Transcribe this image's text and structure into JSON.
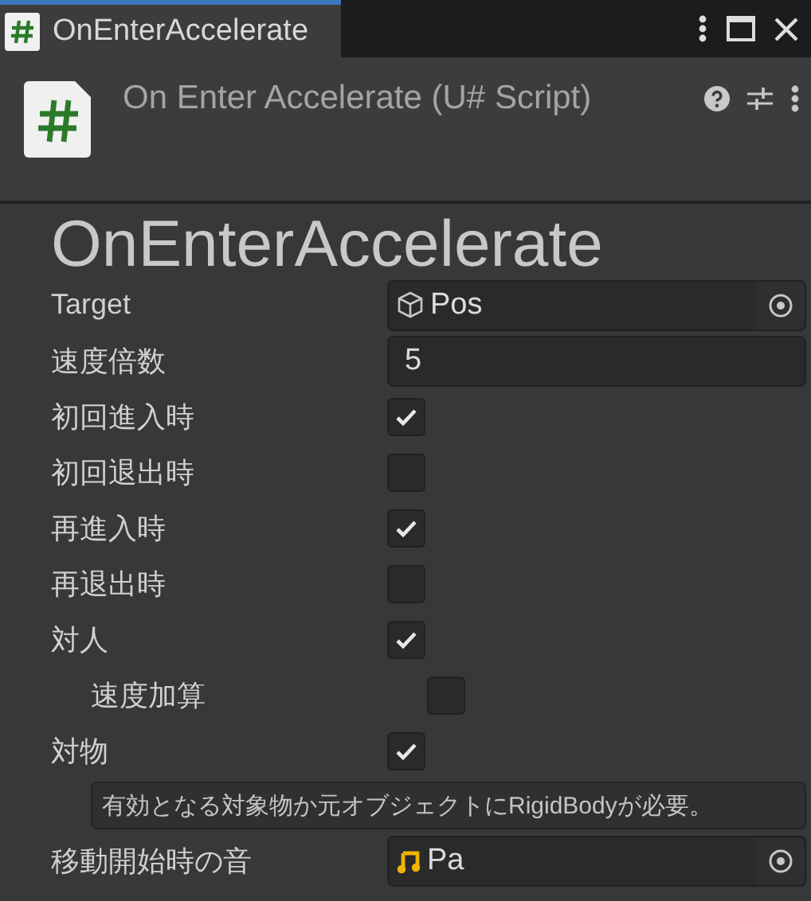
{
  "tab": {
    "title": "OnEnterAccelerate",
    "selected": true
  },
  "header": {
    "title": "On Enter Accelerate (U# Script)"
  },
  "heading": "OnEnterAccelerate",
  "fields": [
    {
      "kind": "object",
      "label": "Target",
      "value": "Pos"
    },
    {
      "kind": "text",
      "label": "速度倍数",
      "value": "5"
    },
    {
      "kind": "checkbox",
      "label": "初回進入時",
      "checked": true
    },
    {
      "kind": "checkbox",
      "label": "初回退出時",
      "checked": false
    },
    {
      "kind": "checkbox",
      "label": "再進入時",
      "checked": true
    },
    {
      "kind": "checkbox",
      "label": "再退出時",
      "checked": false
    },
    {
      "kind": "checkbox",
      "label": "対人",
      "checked": true,
      "children": [
        {
          "kind": "checkbox",
          "label": "速度加算",
          "checked": false
        }
      ]
    },
    {
      "kind": "checkbox",
      "label": "対物",
      "checked": true
    },
    {
      "kind": "help",
      "text": "有効となる対象物か元オブジェクトにRigidBodyが必要。"
    },
    {
      "kind": "audio",
      "label": "移動開始時の音",
      "value": "Pa"
    }
  ]
}
